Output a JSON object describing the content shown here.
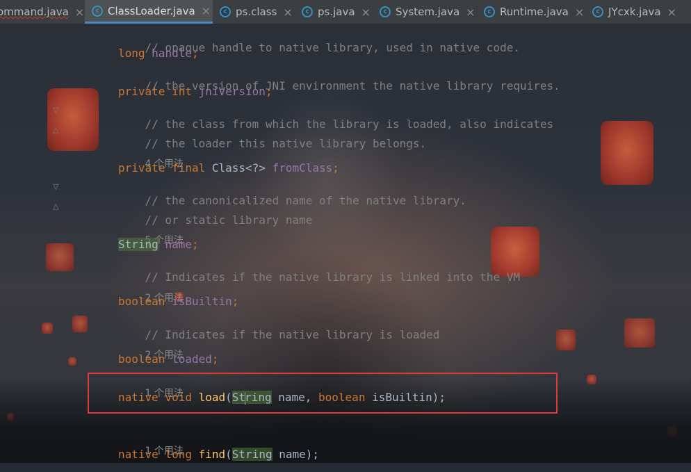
{
  "tabs": [
    {
      "label": "ommand.java",
      "icon": "none",
      "active": false,
      "error": true
    },
    {
      "label": "ClassLoader.java",
      "icon": "class-icon",
      "active": true
    },
    {
      "label": "ps.class",
      "icon": "class-icon",
      "active": false
    },
    {
      "label": "ps.java",
      "icon": "class-icon",
      "active": false
    },
    {
      "label": "System.java",
      "icon": "class-icon",
      "active": false
    },
    {
      "label": "Runtime.java",
      "icon": "class-icon",
      "active": false
    },
    {
      "label": "JYcxk.java",
      "icon": "class-icon",
      "active": false
    }
  ],
  "close_glyph": "×",
  "code": {
    "l1": "// opaque handle to native library, used in native code.",
    "l2_kw": "long",
    "l2_fld": "handle",
    "l2_end": ";",
    "l3": "// the version of JNI environment the native library requires.",
    "l4_kw": "private int",
    "l4_fld": "jniVersion",
    "l4_end": ";",
    "l5": "// the class from which the library is loaded, also indicates",
    "l6": "// the loader this native library belongs.",
    "h7": "4 个用法",
    "l8_kw": "private final",
    "l8_type": "Class<?>",
    "l8_fld": "fromClass",
    "l8_end": ";",
    "l9": "// the canonicalized name of the native library.",
    "l10": "// or static library name",
    "h11": "5 个用法",
    "l12_type": "String",
    "l12_fld": "name",
    "l12_end": ";",
    "l13": "// Indicates if the native library is linked into the VM",
    "h14": "2 个用法",
    "l15_kw": "boolean",
    "l15_fld": "isBuiltin",
    "l15_end": ";",
    "l16": "// Indicates if the native library is loaded",
    "h17": "2 个用法",
    "l18_kw": "boolean",
    "l18_fld": "loaded",
    "l18_end": ";",
    "h19": "1 个用法",
    "l20_kw1": "native void",
    "l20_fn": "load",
    "l20_p1": "(",
    "l20_type_a": "St",
    "l20_type_b": "ring",
    "l20_p2": " name, ",
    "l20_kw2": "boolean",
    "l20_p3": " isBuiltin);",
    "h21": "1 个用法",
    "l22_kw": "native long",
    "l22_fn": "find",
    "l22_p1": "(",
    "l22_type": "String",
    "l22_p2": " name);"
  },
  "colors": {
    "comment": "#808080",
    "keyword": "#cc7832",
    "field": "#9876aa",
    "method": "#ffc66d",
    "text": "#a9b7c6",
    "highlight_box": "#e23a3a"
  }
}
